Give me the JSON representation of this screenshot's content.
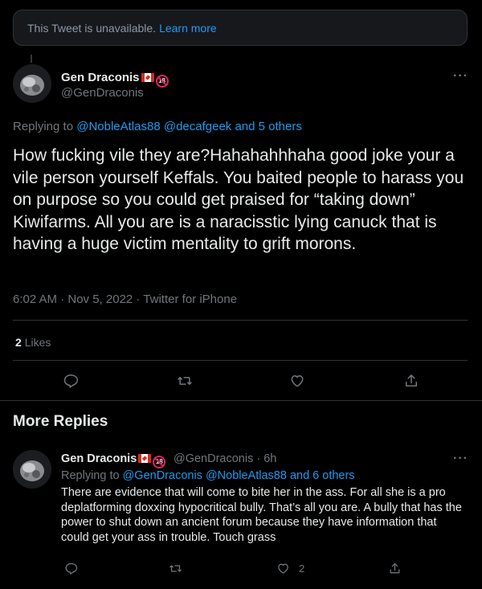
{
  "unavailable_notice": {
    "text": "This Tweet is unavailable.",
    "link": "Learn more"
  },
  "main_tweet": {
    "display_name": "Gen Draconis",
    "handle": "@GenDraconis",
    "replying_prefix": "Replying to",
    "replying_mentions": "@NobleAtlas88 @decafgeek and 5 others",
    "body": "How fucking vile they are?Hahahahhhaha good joke your a vile person yourself Keffals. You baited people to harass you on purpose so you could get praised for “taking down” Kiwifarms. All you are is a naracisstic lying canuck that is having a huge victim mentality to grift morons.",
    "meta": "6:02 AM · Nov 5, 2022 · Twitter for iPhone",
    "likes_count": "2",
    "likes_label": "Likes",
    "more": "···"
  },
  "more_replies": {
    "title": "More Replies",
    "reply": {
      "display_name": "Gen Draconis",
      "handle_time": "@GenDraconis · 6h",
      "replying_prefix": "Replying to",
      "replying_mentions": "@GenDraconis @NobleAtlas88 and 6 others",
      "body": "There are evidence that will come to bite her in the ass. For all she is a pro deplatforming doxxing hypocritical bully. That’s all you are. A bully that has the power to shut down an ancient forum because they have information that could get your ass in trouble. Touch grass",
      "like_count": "2",
      "more": "···"
    }
  },
  "badges": {
    "age": "18"
  },
  "colors": {
    "accent": "#1d9bf0",
    "background": "#000000",
    "muted": "#71767b",
    "divider": "#2f3336"
  },
  "icons": [
    "reply-icon",
    "retweet-icon",
    "like-icon",
    "share-icon",
    "more-icon",
    "canada-flag-icon",
    "no-under-18-icon"
  ]
}
